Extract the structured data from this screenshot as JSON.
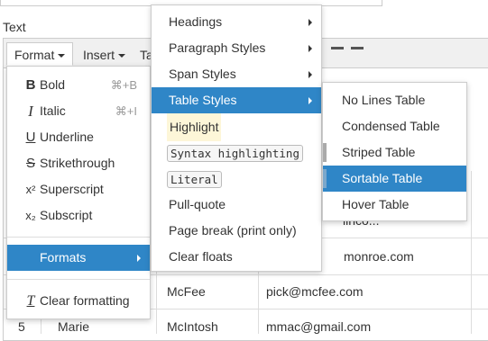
{
  "field_label": "Text",
  "toolbar": {
    "format_label": "Format",
    "insert_label": "Insert",
    "t_label": "Ta"
  },
  "format_menu": {
    "items": [
      {
        "icon": "B",
        "label": "Bold",
        "shortcut": "⌘+B"
      },
      {
        "icon": "I",
        "label": "Italic",
        "shortcut": "⌘+I"
      },
      {
        "icon": "U",
        "label": "Underline",
        "shortcut": ""
      },
      {
        "icon": "S",
        "label": "Strikethrough",
        "shortcut": ""
      },
      {
        "icon": "x²",
        "label": "Superscript",
        "shortcut": ""
      },
      {
        "icon": "x₂",
        "label": "Subscript",
        "shortcut": ""
      }
    ],
    "formats_label": "Formats",
    "clear_label": "Clear formatting"
  },
  "formats_menu": {
    "items": [
      {
        "label": "Headings",
        "submenu": true
      },
      {
        "label": "Paragraph Styles",
        "submenu": true
      },
      {
        "label": "Span Styles",
        "submenu": true
      },
      {
        "label": "Table Styles",
        "submenu": true
      },
      {
        "label": "Highlight",
        "submenu": false
      },
      {
        "label": "Syntax highlighting",
        "submenu": false
      },
      {
        "label": "Literal",
        "submenu": false
      },
      {
        "label": "Pull-quote",
        "submenu": false
      },
      {
        "label": "Page break (print only)",
        "submenu": false
      },
      {
        "label": "Clear floats",
        "submenu": false
      }
    ]
  },
  "table_styles_menu": {
    "items": [
      "No Lines Table",
      "Condensed Table",
      "Striped Table",
      "Sortable Table",
      "Hover Table"
    ]
  },
  "table": {
    "row1_email": "linco...",
    "row2_email": "monroe.com",
    "row3_last": "McFee",
    "row3_email": "pick@mcfee.com",
    "row4_num": "5",
    "row4_first": "Marie",
    "row4_last": "McIntosh",
    "row4_email": "mmac@gmail.com"
  },
  "colors": {
    "accent": "#2f86c7",
    "highlight_bg": "#fdf6d8"
  }
}
